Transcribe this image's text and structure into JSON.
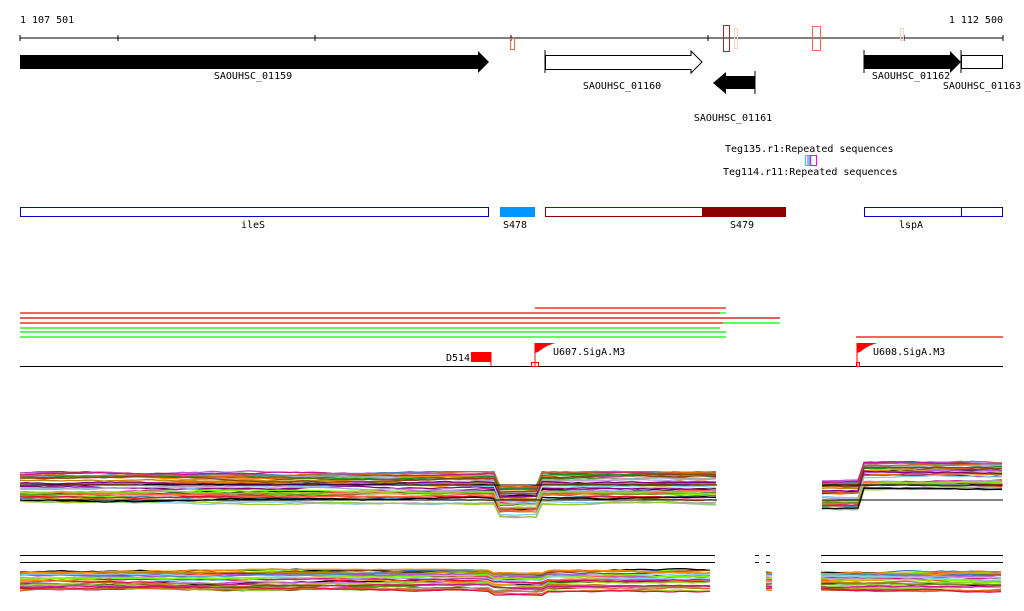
{
  "ruler": {
    "start_label": "1 107 501",
    "end_label": "1 112 500"
  },
  "genes": [
    {
      "name": "SAOUHSC_01159",
      "strand": "+",
      "style": "filled"
    },
    {
      "name": "SAOUHSC_01160",
      "strand": "+",
      "style": "outline"
    },
    {
      "name": "SAOUHSC_01161",
      "strand": "-",
      "style": "filled"
    },
    {
      "name": "SAOUHSC_01162",
      "strand": "+",
      "style": "filled"
    },
    {
      "name": "SAOUHSC_01163",
      "strand": "+",
      "style": "outline"
    }
  ],
  "repeats": [
    {
      "label": "Teg135.r1:Repeated sequences",
      "color": "#00e5ff"
    },
    {
      "label": "Teg114.r11:Repeated sequences",
      "color": "#ff00ff"
    }
  ],
  "features": [
    {
      "label": "ileS"
    },
    {
      "label": "S478",
      "color": "#0096ff"
    },
    {
      "label": "S479",
      "color": "#8b0000"
    },
    {
      "label": "lspA"
    }
  ],
  "sites": {
    "d514": "D514",
    "flags": [
      {
        "label": "U607.SigA.M3"
      },
      {
        "label": "U608.SigA.M3"
      }
    ]
  },
  "colors": {
    "red": "#ff0000",
    "green": "#00ff00",
    "outline_blue": "#0000cc"
  },
  "expression_palette": [
    "#000000",
    "#8b4513",
    "#ff6347",
    "#9acd32",
    "#ba55d3",
    "#b8860b",
    "#4682b4",
    "#dc143c",
    "#7cfc00",
    "#ff8c00",
    "#87ceeb",
    "#c71585",
    "#a9a9a9",
    "#228b22",
    "#800080",
    "#d2691e",
    "#6b8e23",
    "#b0a0d0"
  ]
}
